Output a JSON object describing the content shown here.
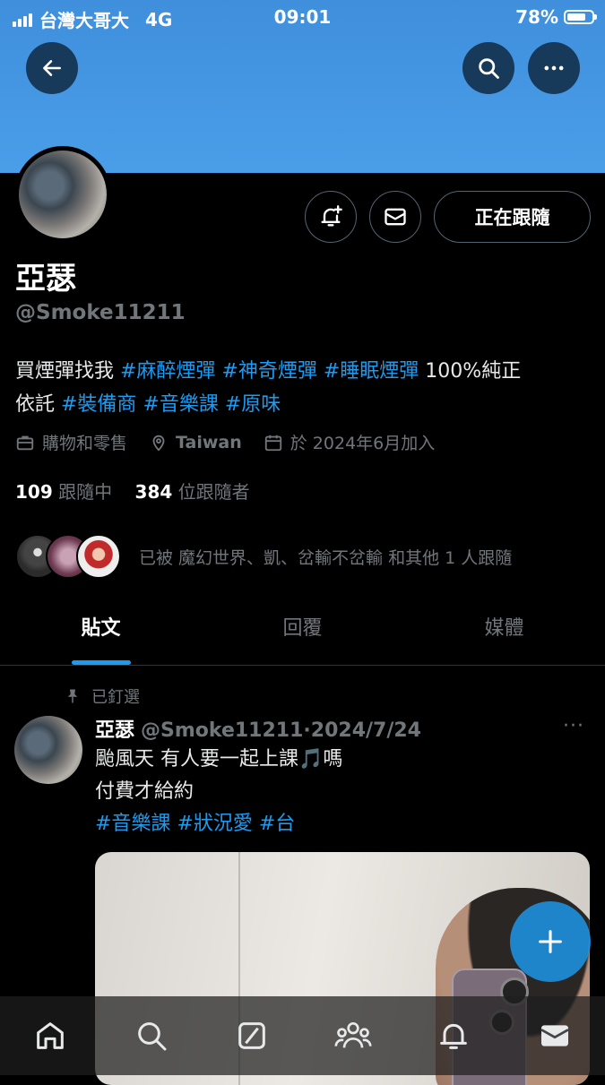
{
  "status_bar": {
    "carrier": "台灣大哥大",
    "network": "4G",
    "time": "09:01",
    "battery": "78%",
    "battery_level": 0.78
  },
  "profile": {
    "name": "亞瑟",
    "handle": "@Smoke11211",
    "bio": {
      "text1": "買煙彈找我 ",
      "tag1": "#麻醉煙彈",
      "tag2": "#神奇煙彈",
      "tag3": "#睡眠煙彈",
      "text2": " 100%純正",
      "text3": "依託 ",
      "tag4": "#裝備商",
      "tag5": "#音樂課",
      "tag6": "#原味"
    },
    "category": "購物和零售",
    "location": "Taiwan",
    "joined": "於 2024年6月加入",
    "following_count": "109",
    "following_label": "跟隨中",
    "followers_count": "384",
    "followers_label": "位跟隨者",
    "followed_by_text": "已被 魔幻世界、凱、岔輸不岔輸 和其他 1 人跟隨",
    "follow_button": "正在跟隨"
  },
  "tabs": [
    {
      "label": "貼文",
      "active": true
    },
    {
      "label": "回覆",
      "active": false
    },
    {
      "label": "媒體",
      "active": false
    }
  ],
  "post": {
    "pinned_label": "已釘選",
    "author": "亞瑟",
    "handle": "@Smoke11211",
    "separator": "·",
    "date": "2024/7/24",
    "line1a": "颱風天 有人要一起上課",
    "note_emoji": "🎵",
    "line1b": "嗎",
    "line2": "付費才給約",
    "tag1": "#音樂課",
    "tag2": "#狀況愛",
    "tag3": "#台",
    "more": "···"
  },
  "colors": {
    "accent": "#1d9bf0",
    "banner": "#4a9ee8",
    "muted": "#71767b"
  },
  "icons": {
    "back": "back-arrow-icon",
    "search": "search-icon",
    "more": "more-icon",
    "notify": "bell-plus-icon",
    "message": "envelope-icon",
    "category": "briefcase-icon",
    "location": "location-pin-icon",
    "joined": "calendar-icon",
    "pin": "pin-icon",
    "compose": "plus-icon",
    "nav": [
      "home-icon",
      "search-icon",
      "compose-icon",
      "communities-icon",
      "bell-icon",
      "mail-icon"
    ]
  }
}
